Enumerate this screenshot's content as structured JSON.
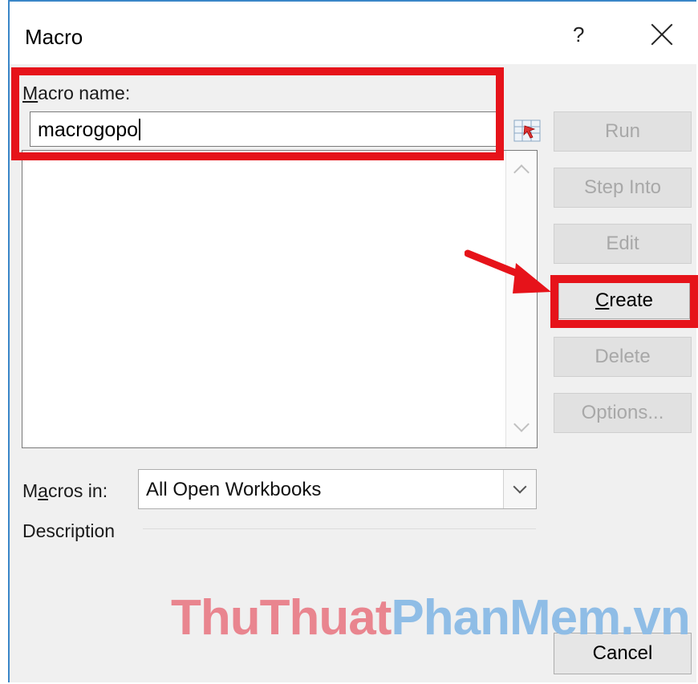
{
  "dialog": {
    "title": "Macro",
    "help_label": "?",
    "macro_name_label": "Macro name:",
    "macro_name_value": "macrogopo",
    "macros_in_label": "Macros in:",
    "macros_in_value": "All Open Workbooks",
    "description_label": "Description"
  },
  "buttons": {
    "run": "Run",
    "step_into": "Step Into",
    "edit": "Edit",
    "create": "Create",
    "delete": "Delete",
    "options": "Options...",
    "cancel": "Cancel"
  },
  "watermark": {
    "part1": "ThuThuat",
    "part2": "PhanMem.vn"
  },
  "colors": {
    "highlight": "#e6131a",
    "dialog_border": "#3a86c8",
    "watermark_red": "#e9858f",
    "watermark_blue": "#8fbde6"
  },
  "icons": [
    "close-icon",
    "macro-picker-icon",
    "scroll-up-icon",
    "scroll-down-icon",
    "dropdown-arrow-icon",
    "arrow-pointer-icon"
  ]
}
